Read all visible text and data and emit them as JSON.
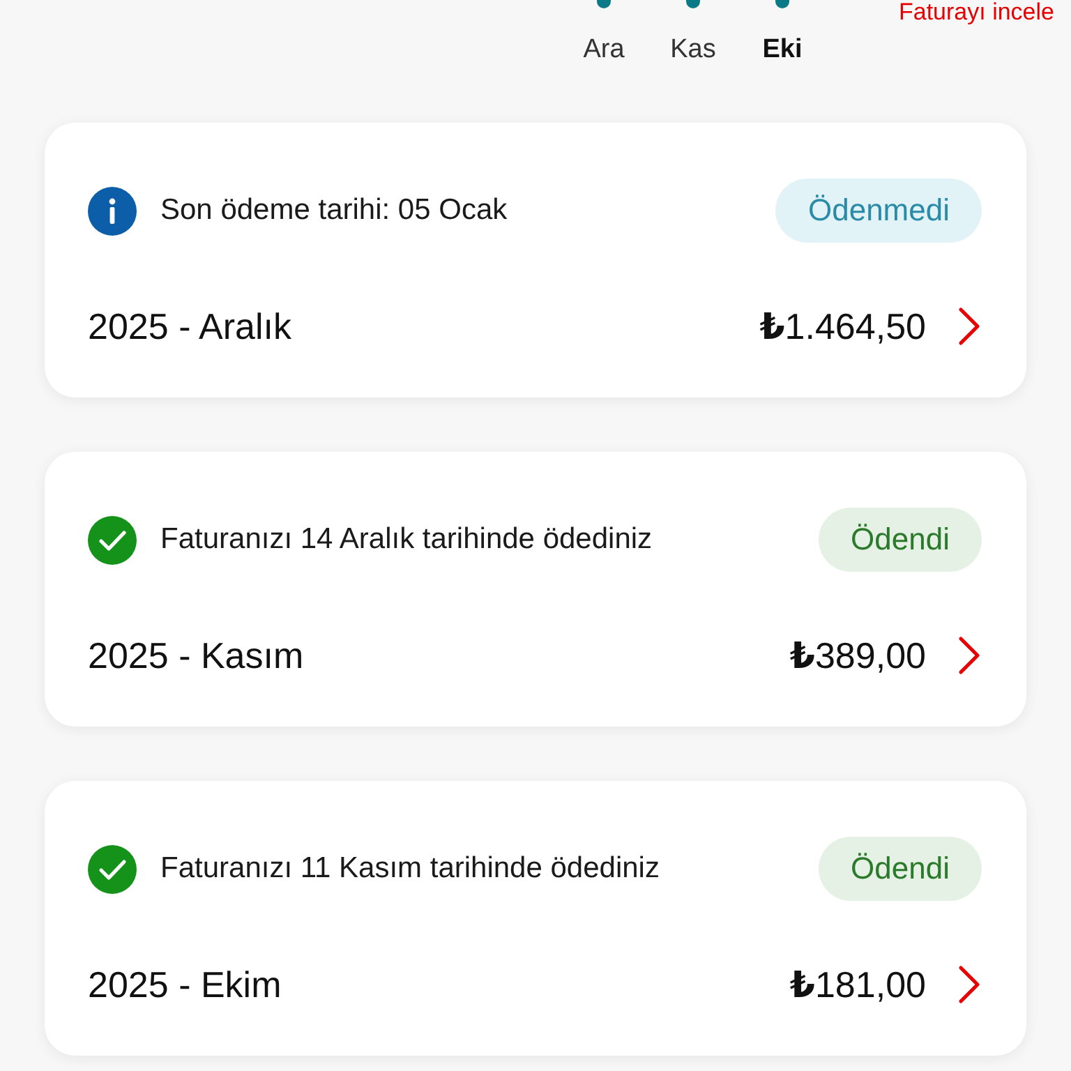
{
  "chart": {
    "months": [
      {
        "label": "Ara",
        "selected": false
      },
      {
        "label": "Kas",
        "selected": false
      },
      {
        "label": "Eki",
        "selected": true
      }
    ]
  },
  "invoice_link": {
    "label": "Faturayı incele"
  },
  "bills": [
    {
      "kind": "unpaid",
      "note": "Son ödeme tarihi: 05 Ocak",
      "badge": "Ödenmedi",
      "period": "2025 - Aralık",
      "amount": "**₺**1.464,50"
    },
    {
      "kind": "paid",
      "note": "Faturanızı 14 Aralık tarihinde ödediniz",
      "badge": "Ödendi",
      "period": "2025 - Kasım",
      "amount": "**₺**389,00"
    },
    {
      "kind": "paid",
      "note": "Faturanızı 11 Kasım tarihinde ödediniz",
      "badge": "Ödendi",
      "period": "2025 - Ekim",
      "amount": "**₺**181,00"
    }
  ]
}
